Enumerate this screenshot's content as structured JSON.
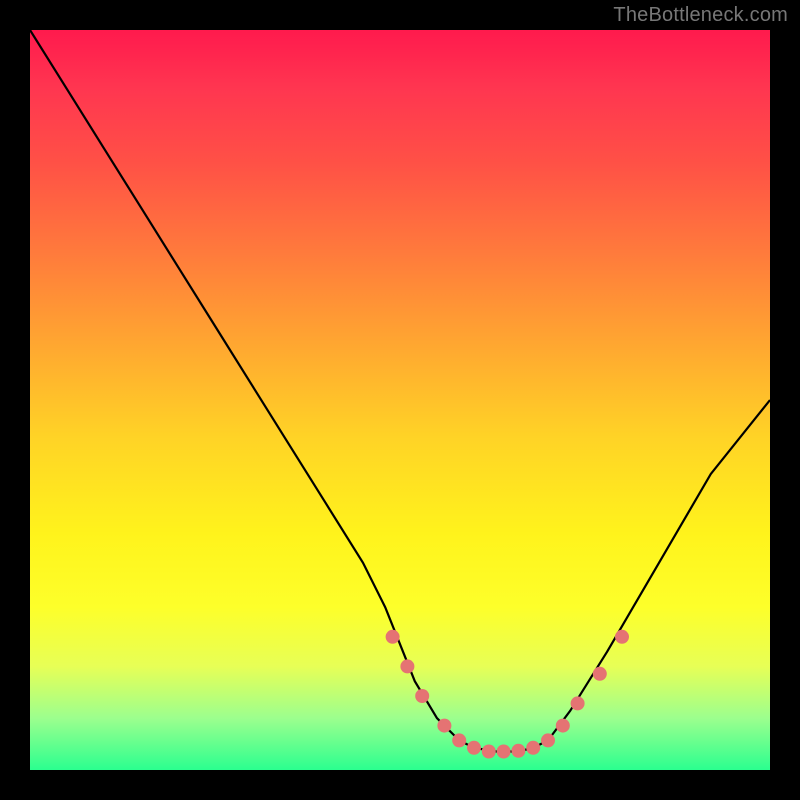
{
  "watermark": "TheBottleneck.com",
  "chart_data": {
    "type": "line",
    "title": "",
    "xlabel": "",
    "ylabel": "",
    "xlim": [
      0,
      100
    ],
    "ylim": [
      0,
      100
    ],
    "grid": false,
    "legend": false,
    "series": [
      {
        "name": "curve",
        "color": "#000000",
        "x": [
          0,
          5,
          10,
          15,
          20,
          25,
          30,
          35,
          40,
          45,
          48,
          50,
          52,
          55,
          58,
          60,
          63,
          66,
          68,
          70,
          73,
          78,
          85,
          92,
          100
        ],
        "y": [
          100,
          92,
          84,
          76,
          68,
          60,
          52,
          44,
          36,
          28,
          22,
          17,
          12,
          7,
          4,
          3,
          2.5,
          2.5,
          3,
          4,
          8,
          16,
          28,
          40,
          50
        ]
      }
    ],
    "markers": {
      "name": "highlighted-points",
      "color": "#e57373",
      "radius": 7,
      "x": [
        49,
        51,
        53,
        56,
        58,
        60,
        62,
        64,
        66,
        68,
        70,
        72,
        74,
        77,
        80
      ],
      "y": [
        18,
        14,
        10,
        6,
        4,
        3,
        2.5,
        2.5,
        2.6,
        3,
        4,
        6,
        9,
        13,
        18
      ]
    }
  }
}
